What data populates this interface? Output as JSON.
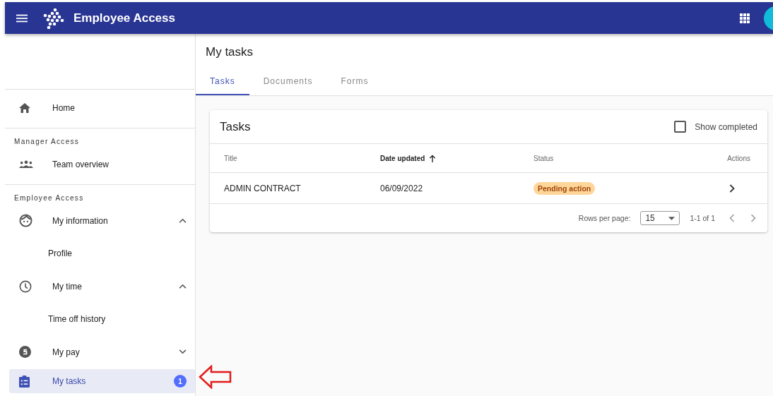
{
  "app_bar": {
    "title": "Employee Access"
  },
  "sidebar": {
    "sections": [
      {
        "items": [
          {
            "label": "Home",
            "selected": false
          }
        ]
      },
      {
        "title": "Manager Access",
        "items": [
          {
            "label": "Team overview",
            "selected": false
          }
        ]
      },
      {
        "title": "Employee Access",
        "items": [
          {
            "label": "My information",
            "selected": false,
            "expanded": true,
            "children": [
              {
                "label": "Profile",
                "selected": false
              }
            ]
          },
          {
            "label": "My time",
            "selected": false,
            "expanded": true,
            "children": [
              {
                "label": "Time off history",
                "selected": false
              }
            ]
          },
          {
            "label": "My pay",
            "selected": false,
            "expanded": false
          },
          {
            "label": "My tasks",
            "selected": true,
            "badge": "1"
          }
        ]
      }
    ]
  },
  "page": {
    "title": "My tasks"
  },
  "tabs": [
    {
      "label": "Tasks",
      "selected": true
    },
    {
      "label": "Documents",
      "selected": false
    },
    {
      "label": "Forms",
      "selected": false
    }
  ],
  "card": {
    "title": "Tasks",
    "show_completed": {
      "label": "Show completed",
      "checked": false
    },
    "table": {
      "columns": [
        {
          "label": "Title",
          "sorted": false
        },
        {
          "label": "Date updated",
          "sorted": true
        },
        {
          "label": "Status",
          "sorted": false
        },
        {
          "label": "Actions",
          "sorted": false
        }
      ],
      "rows": [
        {
          "title": "ADMIN CONTRACT",
          "date": "06/09/2022",
          "status": "Pending action"
        }
      ]
    },
    "pagination": {
      "rows_per_page_label": "Rows per page:",
      "rows_per_page": "15",
      "range": "1-1 of 1"
    }
  }
}
